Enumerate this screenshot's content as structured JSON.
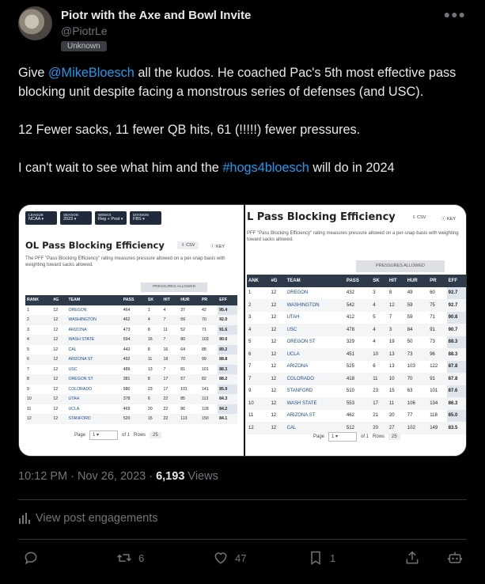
{
  "author": {
    "name": "Piotr with the Axe and Bowl Invite",
    "handle": "@PiotrLe",
    "badge": "Unknown"
  },
  "tweet": {
    "p1_pre": "Give ",
    "p1_mention": "@MikeBloesch",
    "p1_post": " all the kudos. He coached Pac's 5th most effective pass blocking unit despite facing a monstrous series of defenses (and USC).",
    "p2": "12 Fewer sacks, 11 fewer QB hits, 61 (!!!!!) fewer pressures.",
    "p3_pre": "I can't wait to see what him and the ",
    "p3_hashtag": "#hogs4bloesch",
    "p3_post": " will do in 2024"
  },
  "media_left": {
    "filters": [
      {
        "label": "LEAGUE",
        "value": "NCAA"
      },
      {
        "label": "SEASON",
        "value": "2023"
      },
      {
        "label": "WEEKS",
        "value": "Reg + Post"
      },
      {
        "label": "DIVISION",
        "value": "FBS"
      }
    ],
    "title": "OL Pass Blocking Efficiency",
    "csv": "CSV",
    "key": "KEY",
    "description": "The PFF \"Pass Blocking Efficiency\" rating measures pressure allowed on a per-snap basis with weighting toward sacks allowed.",
    "group_header": "PRESSURES ALLOWED",
    "columns": [
      "RANK",
      "#G",
      "TEAM",
      "PASS",
      "SK",
      "HIT",
      "HUR",
      "PR",
      "EFF"
    ],
    "rows": [
      [
        "1",
        "12",
        "OREGON",
        "464",
        "1",
        "4",
        "37",
        "42",
        "95.4"
      ],
      [
        "2",
        "12",
        "WASHINGTON",
        "462",
        "4",
        "7",
        "59",
        "70",
        "92.0"
      ],
      [
        "3",
        "12",
        "ARIZONA",
        "473",
        "8",
        "11",
        "52",
        "71",
        "91.6"
      ],
      [
        "4",
        "12",
        "WASH STATE",
        "594",
        "16",
        "7",
        "80",
        "103",
        "90.0"
      ],
      [
        "5",
        "12",
        "CAL",
        "443",
        "8",
        "16",
        "64",
        "88",
        "89.2"
      ],
      [
        "6",
        "12",
        "ARIZONA ST",
        "492",
        "11",
        "18",
        "70",
        "99",
        "88.8"
      ],
      [
        "7",
        "12",
        "USC",
        "489",
        "13",
        "7",
        "81",
        "101",
        "88.3"
      ],
      [
        "8",
        "12",
        "OREGON ST",
        "381",
        "8",
        "17",
        "57",
        "82",
        "88.2"
      ],
      [
        "9",
        "12",
        "COLORADO",
        "580",
        "23",
        "17",
        "101",
        "141",
        "85.9"
      ],
      [
        "10",
        "12",
        "UTAH",
        "378",
        "6",
        "22",
        "85",
        "113",
        "84.3"
      ],
      [
        "11",
        "12",
        "UCLA",
        "469",
        "20",
        "22",
        "86",
        "128",
        "84.2"
      ],
      [
        "12",
        "12",
        "STANFORD",
        "520",
        "15",
        "22",
        "113",
        "150",
        "84.1"
      ]
    ],
    "page_label": "Page",
    "page_value": "1",
    "of_label": "of 1",
    "rows_label": "Rows",
    "rows_value": "25"
  },
  "media_right": {
    "title": "L Pass Blocking Efficiency",
    "csv": "CSV",
    "key": "KEY",
    "description": "PFF \"Pass Blocking Efficiency\" rating measures pressure allowed on a per-snap basis with weighting toward sacks allowed.",
    "group_header": "PRESSURES ALLOWED",
    "columns": [
      "ANK",
      "#G",
      "TEAM",
      "PASS",
      "SK",
      "HIT",
      "HUR",
      "PR",
      "EFF"
    ],
    "rows": [
      [
        "1",
        "12",
        "OREGON",
        "432",
        "3",
        "8",
        "49",
        "60",
        "92.7"
      ],
      [
        "2",
        "12",
        "WASHINGTON",
        "542",
        "4",
        "12",
        "59",
        "75",
        "92.7"
      ],
      [
        "3",
        "12",
        "UTAH",
        "412",
        "5",
        "7",
        "59",
        "71",
        "90.8"
      ],
      [
        "4",
        "12",
        "USC",
        "478",
        "4",
        "3",
        "84",
        "91",
        "90.7"
      ],
      [
        "5",
        "12",
        "OREGON ST",
        "329",
        "4",
        "19",
        "50",
        "73",
        "88.3"
      ],
      [
        "6",
        "12",
        "UCLA",
        "451",
        "10",
        "13",
        "73",
        "96",
        "88.3"
      ],
      [
        "7",
        "12",
        "ARIZONA",
        "525",
        "6",
        "13",
        "103",
        "122",
        "87.8"
      ],
      [
        "7",
        "12",
        "COLORADO",
        "418",
        "11",
        "10",
        "70",
        "91",
        "87.8"
      ],
      [
        "9",
        "12",
        "STANFORD",
        "510",
        "23",
        "15",
        "63",
        "101",
        "87.6"
      ],
      [
        "10",
        "12",
        "WASH STATE",
        "553",
        "17",
        "11",
        "106",
        "134",
        "86.3"
      ],
      [
        "11",
        "12",
        "ARIZONA ST",
        "462",
        "21",
        "20",
        "77",
        "118",
        "85.0"
      ],
      [
        "12",
        "12",
        "CAL",
        "512",
        "20",
        "27",
        "102",
        "149",
        "83.5"
      ]
    ],
    "page_label": "Page",
    "page_value": "1",
    "of_label": "of 1",
    "rows_label": "Rows",
    "rows_value": "25"
  },
  "meta": {
    "time": "10:12 PM · Nov 26, 2023 · ",
    "views_count": "6,193",
    "views_label": " Views"
  },
  "engagements_label": "View post engagements",
  "actions": {
    "replies": "",
    "reposts": "6",
    "likes": "47",
    "bookmarks": "1"
  },
  "colors": {
    "link": "#1d9bf0",
    "background": "#000000",
    "muted": "#71767b",
    "table_header": "#2d3a4a"
  }
}
